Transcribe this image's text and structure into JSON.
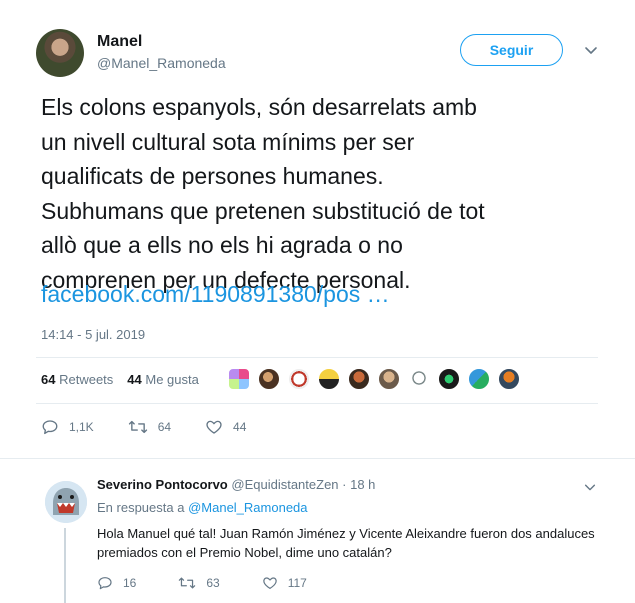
{
  "tweet": {
    "author_name": "Manel",
    "author_handle": "@Manel_Ramoneda",
    "follow_label": "Seguir",
    "text": "Els colons espanyols, són desarrelats amb\nun nivell cultural sota mínims per ser\nqualificats de persones humanes.\nSubhumans que pretenen substitució de tot\nallò que a ells no els hi agrada o no\ncomprenen per un defecte personal.",
    "link": "facebook.com/1190891380/pos …",
    "timestamp": "14:14 - 5 jul. 2019",
    "retweets_count": "64",
    "retweets_label": "Retweets",
    "likes_count": "44",
    "likes_label": "Me gusta",
    "replies": "1,1K",
    "retweets": "64",
    "likes": "44"
  },
  "reply": {
    "author_name": "Severino Pontocorvo",
    "author_handle": "@EquidistanteZen",
    "time": "· 18 h",
    "reply_prefix": "En respuesta a",
    "reply_to": "@Manel_Ramoneda",
    "text": "Hola Manuel qué tal! Juan Ramón Jiménez y Vicente Aleixandre fueron dos andaluces premiados con el Premio Nobel, dime uno catalán?",
    "replies": "16",
    "retweets": "63",
    "likes": "117"
  },
  "colors": {
    "accent": "#1da1f2",
    "link": "#1b95e0",
    "muted": "#657786",
    "text": "#14171a",
    "divider": "#e6ecf0"
  },
  "icons": [
    "chevron-down-icon",
    "reply-icon",
    "retweet-icon",
    "like-icon"
  ]
}
